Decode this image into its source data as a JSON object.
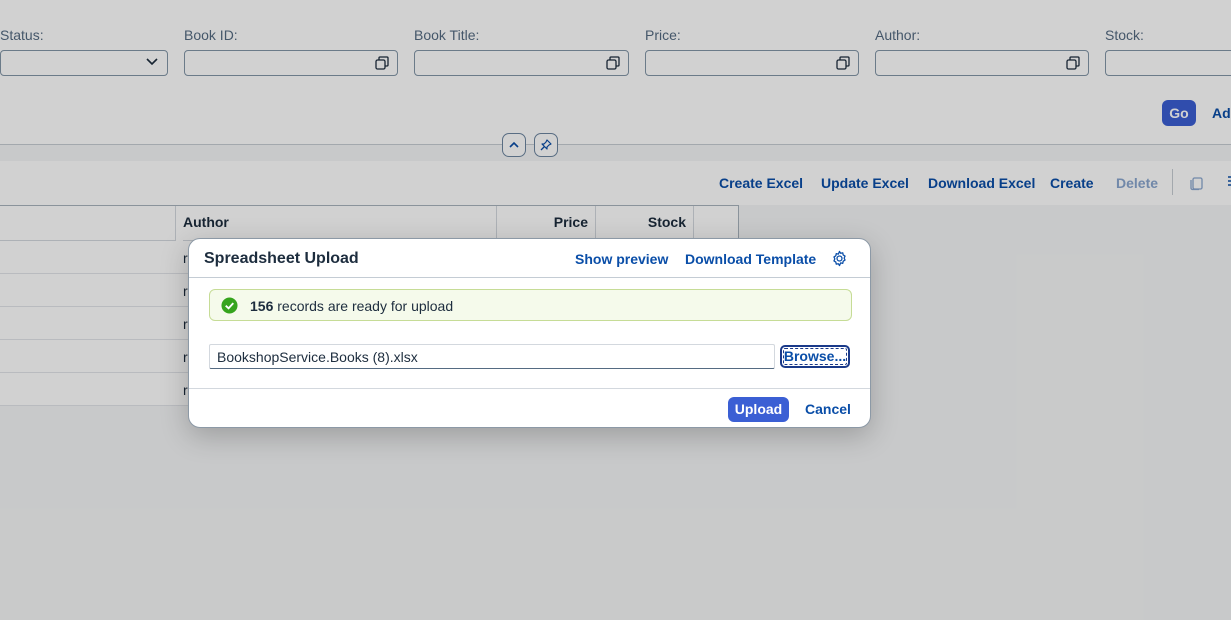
{
  "filters": [
    {
      "label": "Status:",
      "type": "select",
      "value": ""
    },
    {
      "label": "Book ID:",
      "type": "valuehelp",
      "value": ""
    },
    {
      "label": "Book Title:",
      "type": "valuehelp",
      "value": ""
    },
    {
      "label": "Price:",
      "type": "valuehelp",
      "value": ""
    },
    {
      "label": "Author:",
      "type": "valuehelp",
      "value": ""
    },
    {
      "label": "Stock:",
      "type": "input",
      "value": ""
    }
  ],
  "filterbar": {
    "go_label": "Go",
    "adapt_label": "Ada"
  },
  "toolbar": {
    "create_excel": "Create Excel",
    "update_excel": "Update Excel",
    "download_excel": "Download Excel",
    "create": "Create",
    "delete": "Delete"
  },
  "table": {
    "columns": [
      "Author",
      "Price",
      "Stock"
    ],
    "row_cells": [
      "r",
      "r",
      "r",
      "r",
      "r"
    ]
  },
  "dialog": {
    "title": "Spreadsheet Upload",
    "show_preview": "Show preview",
    "download_template": "Download Template",
    "message_count": "156",
    "message_text": " records are ready for upload",
    "file_name": "BookshopService.Books (8).xlsx",
    "browse_label": "Browse...",
    "upload_label": "Upload",
    "cancel_label": "Cancel"
  },
  "colors": {
    "accent": "#3b5fd4",
    "link": "#0a4ea8",
    "success": "#36a41d"
  },
  "icons": [
    "value-help-icon",
    "chevron-down-icon",
    "chevron-up-icon",
    "pin-icon",
    "copy-icon",
    "settings-gear-icon",
    "success-check-icon"
  ]
}
